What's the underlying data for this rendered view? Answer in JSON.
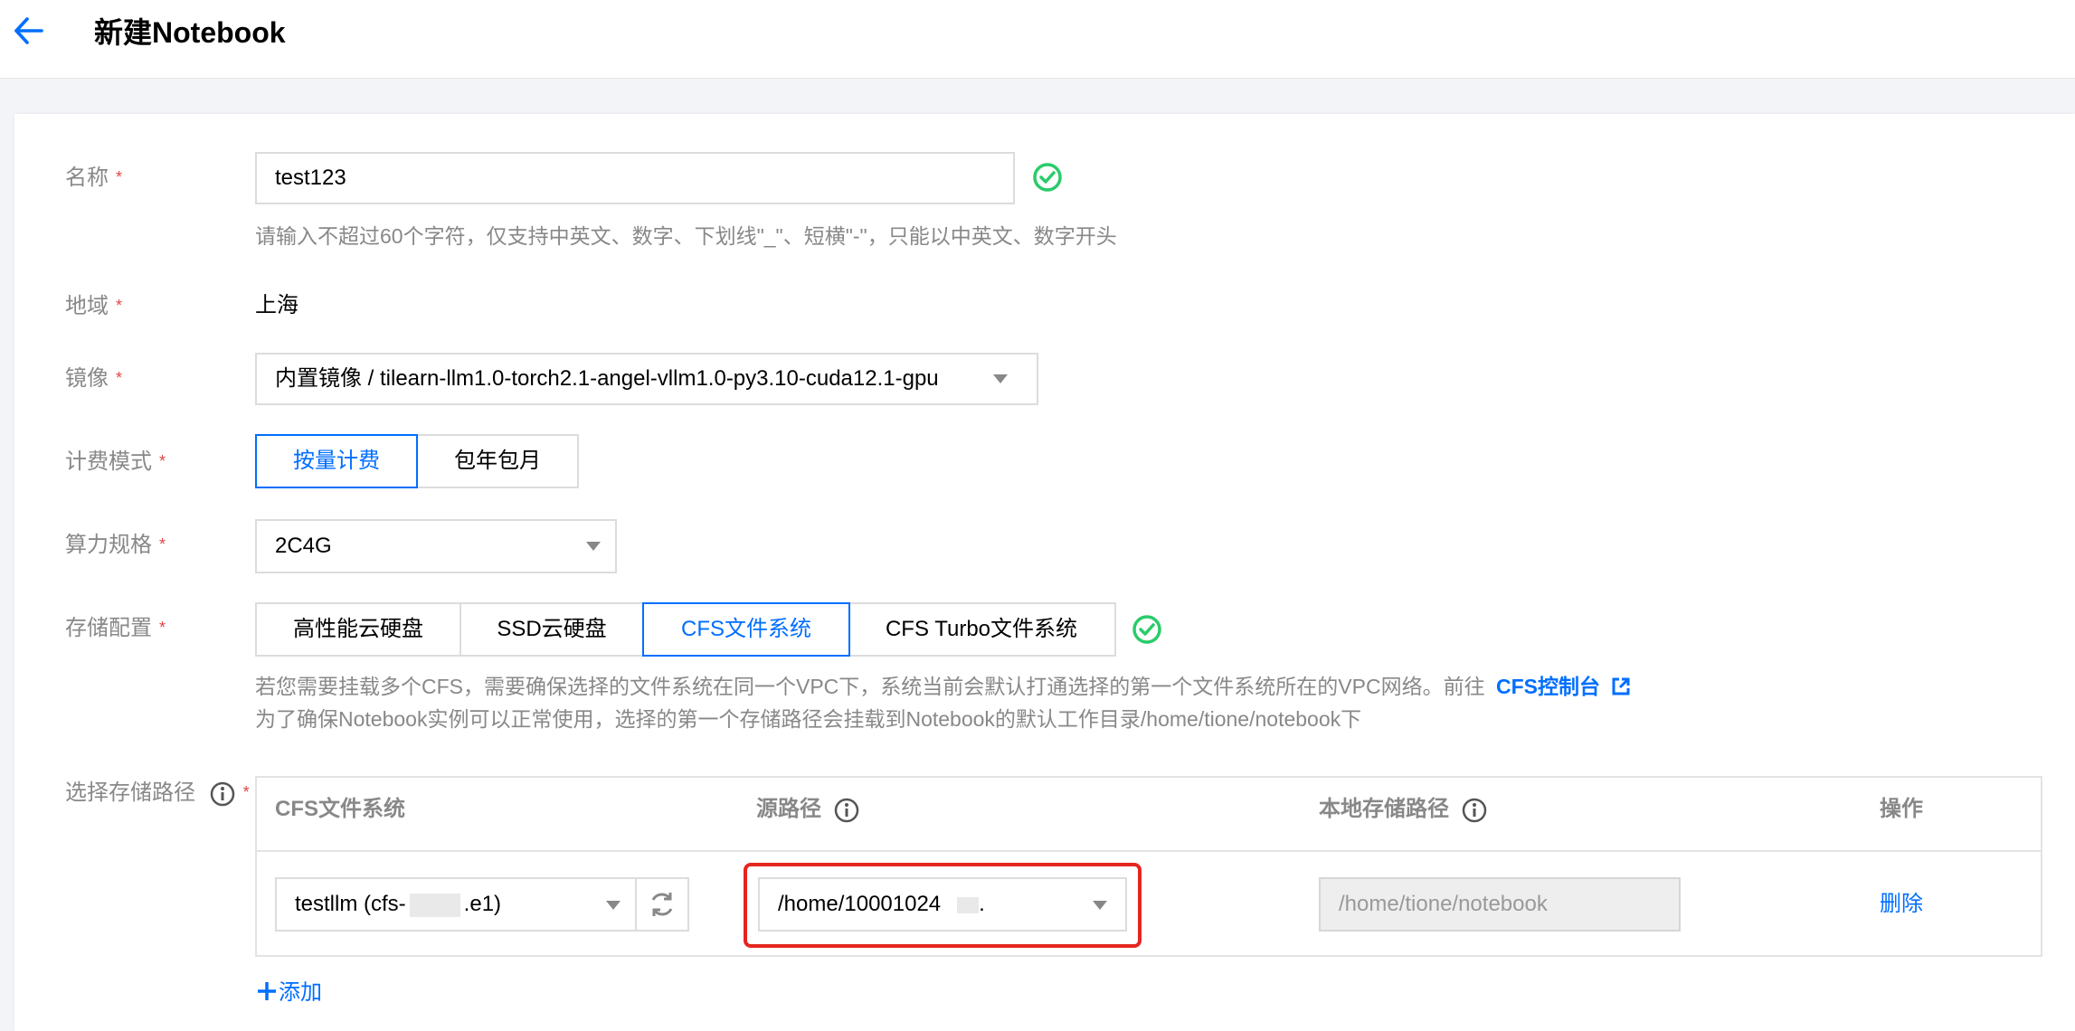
{
  "header": {
    "title": "新建Notebook"
  },
  "form": {
    "name": {
      "label": "名称",
      "required_mark": "*",
      "value": "test123",
      "help": "请输入不超过60个字符，仅支持中英文、数字、下划线\"_\"、短横\"-\"，只能以中英文、数字开头"
    },
    "region": {
      "label": "地域",
      "required_mark": "*",
      "value": "上海"
    },
    "image": {
      "label": "镜像",
      "required_mark": "*",
      "value": "内置镜像 / tilearn-llm1.0-torch2.1-angel-vllm1.0-py3.10-cuda12.1-gpu"
    },
    "billing": {
      "label": "计费模式",
      "required_mark": "*",
      "options": [
        "按量计费",
        "包年包月"
      ],
      "selected": "按量计费"
    },
    "spec": {
      "label": "算力规格",
      "required_mark": "*",
      "value": "2C4G"
    },
    "storage": {
      "label": "存储配置",
      "required_mark": "*",
      "options": [
        "高性能云硬盘",
        "SSD云硬盘",
        "CFS文件系统",
        "CFS Turbo文件系统"
      ],
      "selected": "CFS文件系统",
      "help_line1": "若您需要挂载多个CFS，需要确保选择的文件系统在同一个VPC下，系统当前会默认打通选择的第一个文件系统所在的VPC网络。前往",
      "help_link": "CFS控制台",
      "help_line2": "为了确保Notebook实例可以正常使用，选择的第一个存储路径会挂载到Notebook的默认工作目录/home/tione/notebook下"
    },
    "storage_path": {
      "label": "选择存储路径",
      "required_mark": "*",
      "columns": {
        "cfs": "CFS文件系统",
        "source": "源路径",
        "local": "本地存储路径",
        "action": "操作"
      },
      "row": {
        "cfs_prefix": "testllm (cfs-",
        "cfs_suffix": ".e1)",
        "source_prefix": "/home/10001024",
        "source_suffix": ".",
        "local_placeholder": "/home/tione/notebook",
        "action_label": "删除"
      },
      "add_label": "添加"
    }
  },
  "colors": {
    "accent": "#006eff",
    "success": "#29cc6a",
    "required": "#e54545",
    "highlight": "#e5261f"
  }
}
